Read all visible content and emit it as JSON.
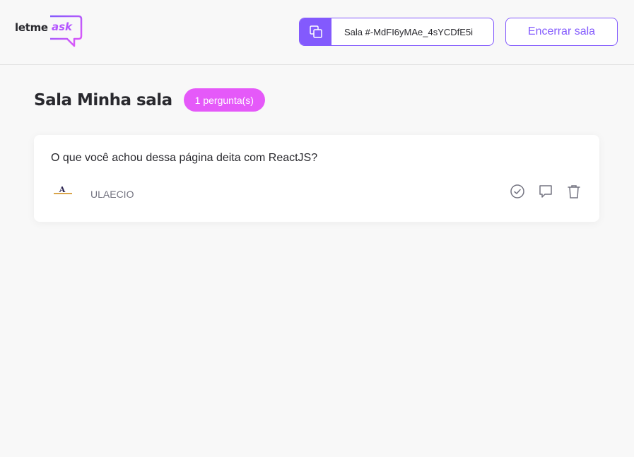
{
  "header": {
    "logo": {
      "text_prefix": "letme",
      "text_accent": "ask"
    },
    "room_code": {
      "label": "Sala #-MdFI6yMAe_4sYCDfE5i",
      "icon": "copy-icon"
    },
    "close_room_label": "Encerrar sala"
  },
  "main": {
    "title": "Sala Minha sala",
    "question_count_badge": "1 pergunta(s)",
    "questions": [
      {
        "content": "O que você achou dessa página deita com ReactJS?",
        "author": {
          "name": "ULAECIO",
          "avatar_letter": "A"
        },
        "actions": [
          "check-circle-icon",
          "answer-icon",
          "delete-icon"
        ]
      }
    ]
  },
  "colors": {
    "primary": "#835afd",
    "badge": "#e559f9",
    "background": "#f8f8f8",
    "text": "#29292e",
    "muted": "#737380"
  }
}
